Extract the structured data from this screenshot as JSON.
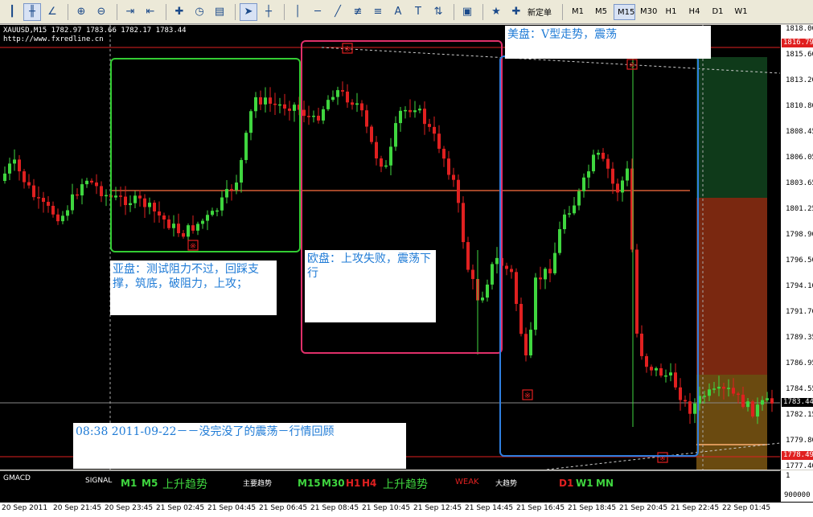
{
  "toolbar": {
    "new_order_label": "新定单",
    "timeframes": [
      "M1",
      "M5",
      "M15",
      "M30",
      "H1",
      "H4",
      "D1",
      "W1"
    ],
    "active_timeframe": "M15"
  },
  "chart": {
    "symbol_line": "XAUUSD,M15  1782.97 1783.66 1782.17 1783.44",
    "source_line": "http://www.fxredline.cn",
    "price_labels": [
      "1818.00",
      "1815.60",
      "1813.20",
      "1810.80",
      "1808.45",
      "1806.05",
      "1803.65",
      "1801.25",
      "1798.90",
      "1796.50",
      "1794.10",
      "1791.70",
      "1789.35",
      "1786.95",
      "1784.55",
      "1782.15",
      "1779.80",
      "1777.40"
    ],
    "price_tag_top": "1816.79",
    "price_tag_current": "1783.44",
    "price_tag_bottom": "1778.49",
    "notes": {
      "us": "美盘：V型走势，震荡",
      "asia": "亚盘：测试阻力不过，回踩支撑，筑底，破阻力，上攻；",
      "europe": "欧盘：上攻失败，震荡下行",
      "review": "08:38 2011-09-22－－没完没了的震荡－行情回顾"
    },
    "marker_glyph": "※"
  },
  "indicator": {
    "name": "GMACD",
    "signal_label": "SIGNAL",
    "group1": {
      "tf1": "M1",
      "tf2": "M5",
      "trend": "上升趋势"
    },
    "main_label": "主要趋势",
    "group2": {
      "tf1": "M15",
      "tf2": "M30",
      "tf3": "H1",
      "tf4": "H4",
      "trend": "上升趋势"
    },
    "weak_label": "WEAK",
    "big_label": "大趋势",
    "group3": {
      "tf1": "D1",
      "tf2": "W1",
      "tf3": "MN"
    },
    "axis_top": "1",
    "axis_bottom": "900000"
  },
  "time_labels": [
    "20 Sep 2011",
    "20 Sep 21:45",
    "20 Sep 23:45",
    "21 Sep 02:45",
    "21 Sep 04:45",
    "21 Sep 06:45",
    "21 Sep 08:45",
    "21 Sep 10:45",
    "21 Sep 12:45",
    "21 Sep 14:45",
    "21 Sep 16:45",
    "21 Sep 18:45",
    "21 Sep 20:45",
    "21 Sep 22:45",
    "22 Sep 01:45"
  ],
  "colors": {
    "bull": "#3fd63f",
    "bear": "#e02020",
    "asia_box": "#33cc33",
    "europe_box": "#e0306a",
    "us_box": "#2f7fe0",
    "note_text": "#1f7bd6"
  }
}
